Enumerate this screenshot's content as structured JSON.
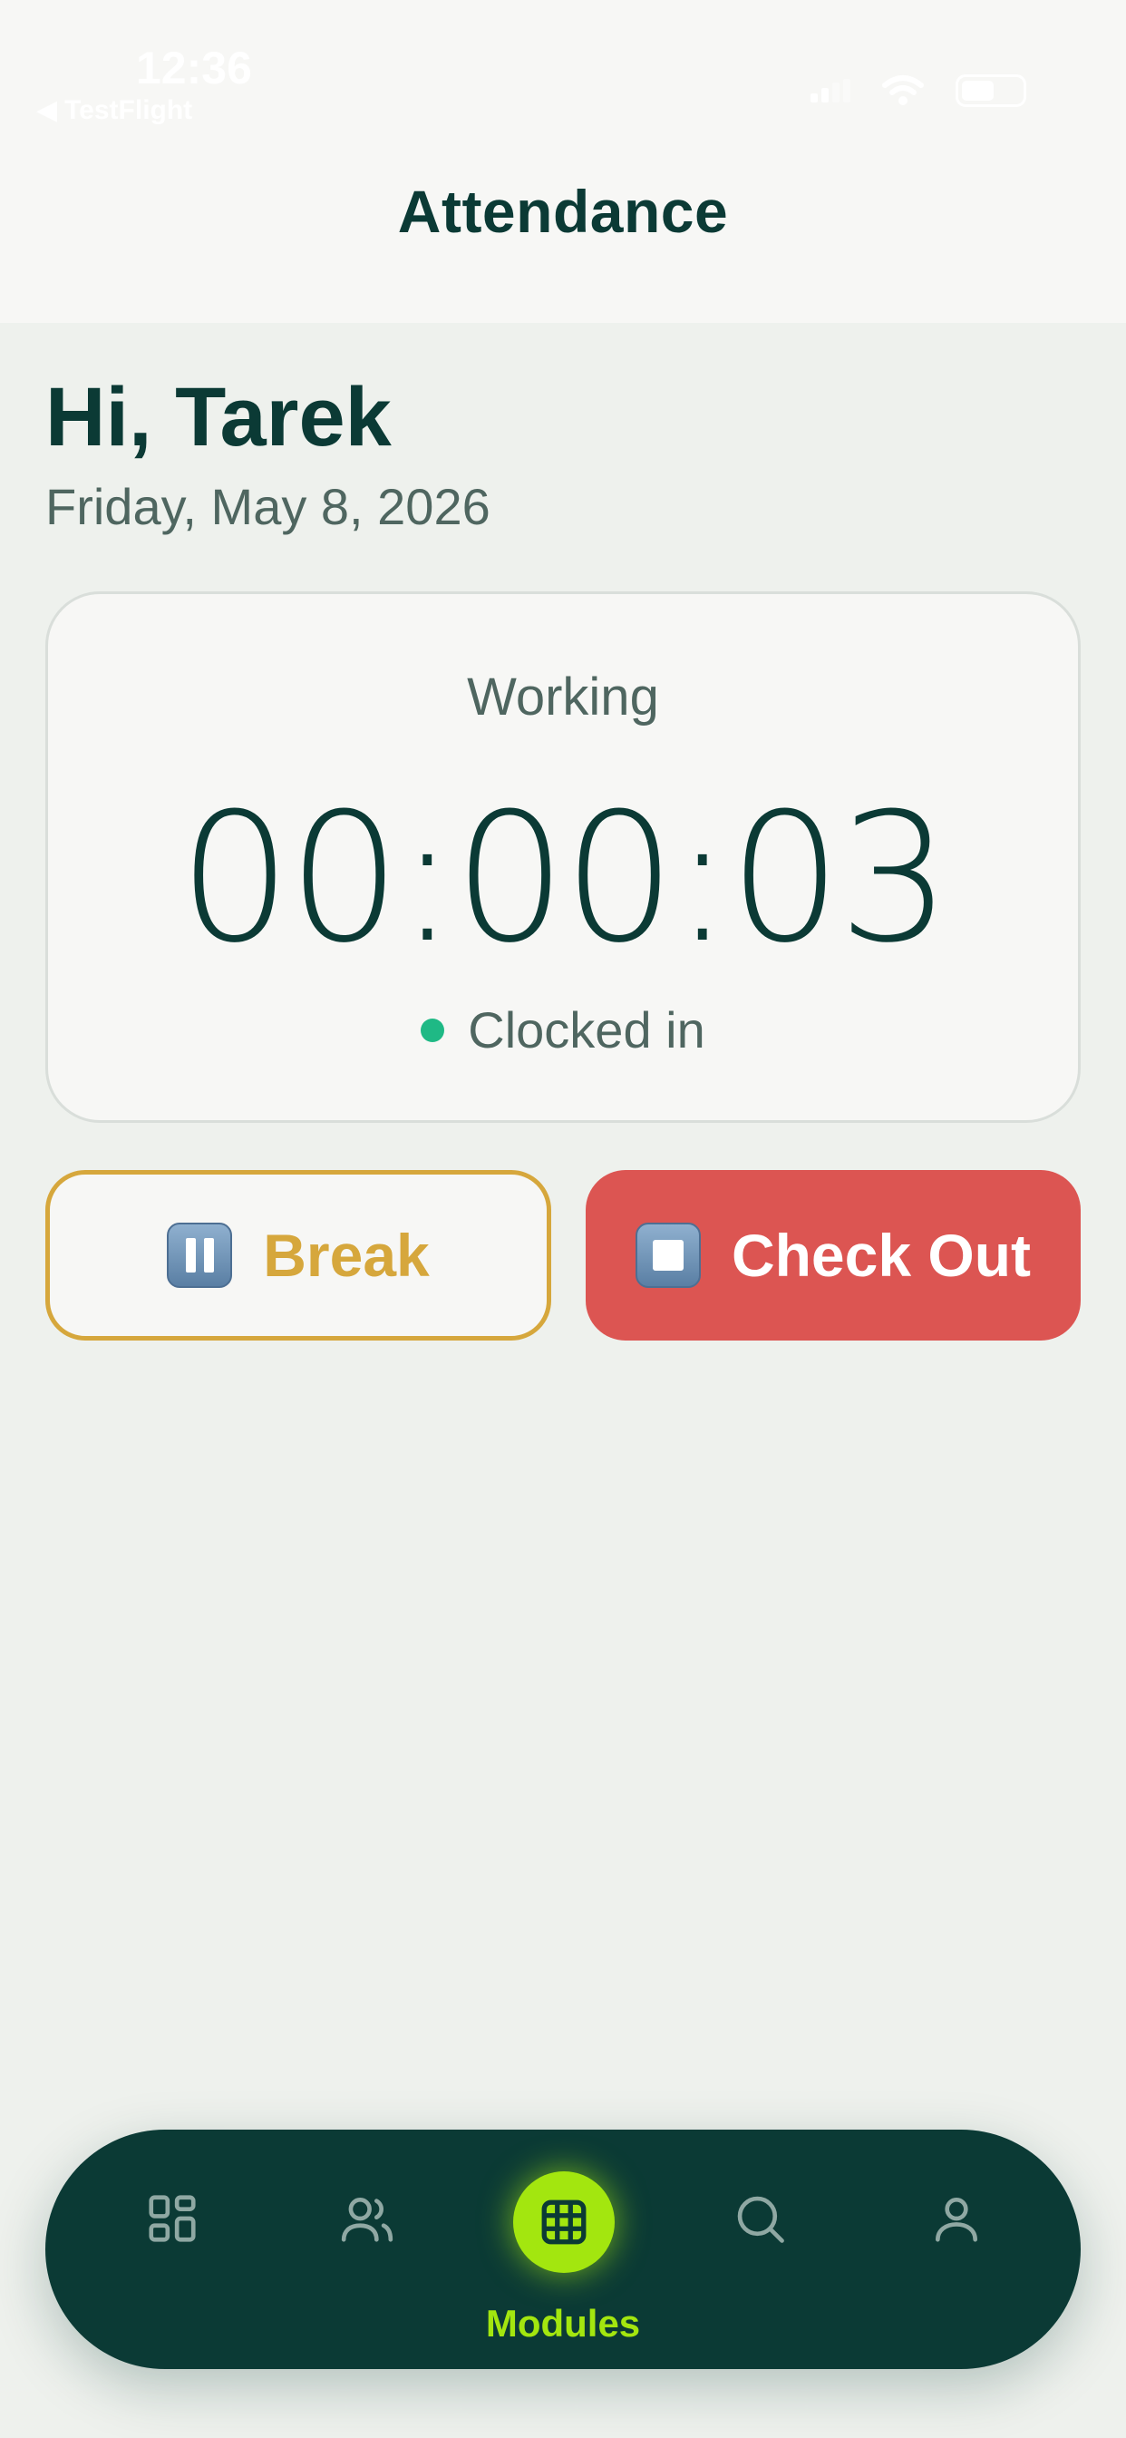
{
  "status_bar": {
    "time": "12:36",
    "back_label": "TestFlight"
  },
  "header": {
    "title": "Attendance"
  },
  "greeting": {
    "text": "Hi, Tarek",
    "date": "Friday, May 8, 2026"
  },
  "timer_card": {
    "status_label": "Working",
    "elapsed": "00:00:03",
    "clock_status": "Clocked in"
  },
  "actions": {
    "break_label": "Break",
    "checkout_label": "Check Out"
  },
  "colors": {
    "primary": "#0b3a35",
    "accent": "#a3e60f",
    "break": "#d6a73c",
    "checkout": "#dc5552",
    "status_dot": "#1fb985"
  },
  "nav": {
    "items": [
      {
        "icon": "dashboard-icon"
      },
      {
        "icon": "users-icon"
      },
      {
        "icon": "modules-grid-icon",
        "label": "Modules",
        "active": true
      },
      {
        "icon": "search-icon"
      },
      {
        "icon": "profile-icon"
      }
    ]
  }
}
